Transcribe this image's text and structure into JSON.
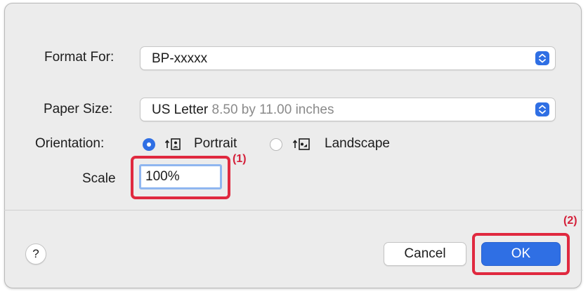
{
  "format_for": {
    "label": "Format For:",
    "value": "BP-xxxxx"
  },
  "paper_size": {
    "label": "Paper Size:",
    "value": "US Letter",
    "detail": "8.50 by 11.00 inches"
  },
  "orientation": {
    "label": "Orientation:",
    "options": [
      {
        "label": "Portrait",
        "selected": true,
        "icon": "portrait-orientation-icon"
      },
      {
        "label": "Landscape",
        "selected": false,
        "icon": "landscape-orientation-icon"
      }
    ]
  },
  "scale": {
    "label": "Scale",
    "value": "100%"
  },
  "footer": {
    "help_label": "?",
    "cancel_label": "Cancel",
    "ok_label": "OK"
  },
  "callouts": {
    "one": "(1)",
    "two": "(2)"
  },
  "colors": {
    "accent": "#2f6fe4",
    "highlight": "#e0293f",
    "dialog_bg": "#ececec"
  }
}
